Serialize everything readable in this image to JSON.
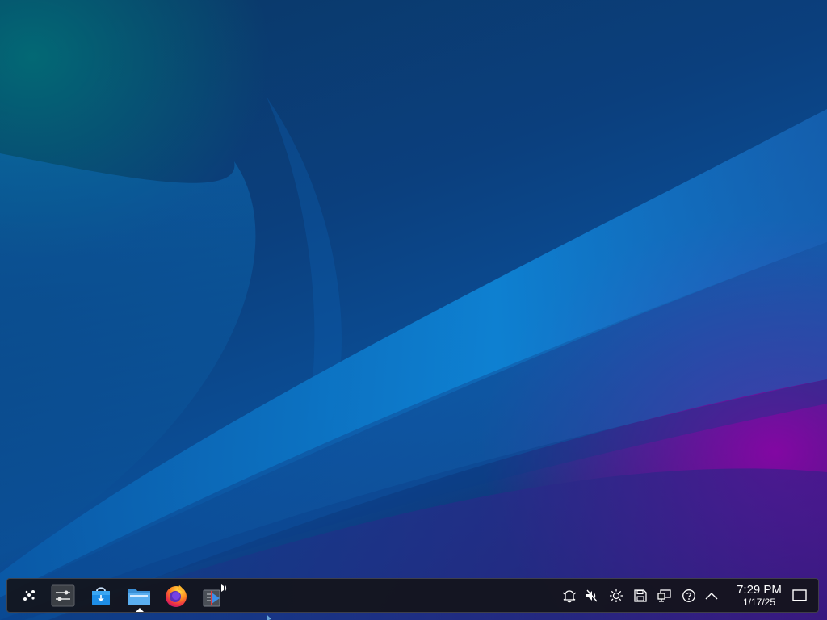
{
  "desktop": {
    "wallpaper": "blue-purple-abstract-waves",
    "colors": {
      "primary": "#0b4f98",
      "accent_purple": "#9600aa",
      "accent_teal": "#007878"
    }
  },
  "taskbar": {
    "launcher": {
      "icon": "app-launcher-icon"
    },
    "pinned": [
      {
        "name": "system-settings",
        "icon": "settings-sliders-icon"
      },
      {
        "name": "discover",
        "icon": "store-bag-icon"
      },
      {
        "name": "dolphin",
        "icon": "folder-icon",
        "active": true
      },
      {
        "name": "firefox",
        "icon": "firefox-icon"
      },
      {
        "name": "media-player",
        "icon": "media-player-icon"
      }
    ],
    "tray": [
      {
        "name": "notifications",
        "icon": "bell-icon"
      },
      {
        "name": "volume",
        "icon": "speaker-muted-icon"
      },
      {
        "name": "brightness",
        "icon": "sun-icon"
      },
      {
        "name": "disks",
        "icon": "disk-icon"
      },
      {
        "name": "network",
        "icon": "network-icon"
      },
      {
        "name": "help",
        "icon": "help-circle-icon"
      },
      {
        "name": "expand",
        "icon": "chevron-up-icon"
      }
    ],
    "clock": {
      "time": "7:29 PM",
      "date": "1/17/25"
    },
    "show_desktop": {
      "icon": "show-desktop-icon"
    }
  }
}
